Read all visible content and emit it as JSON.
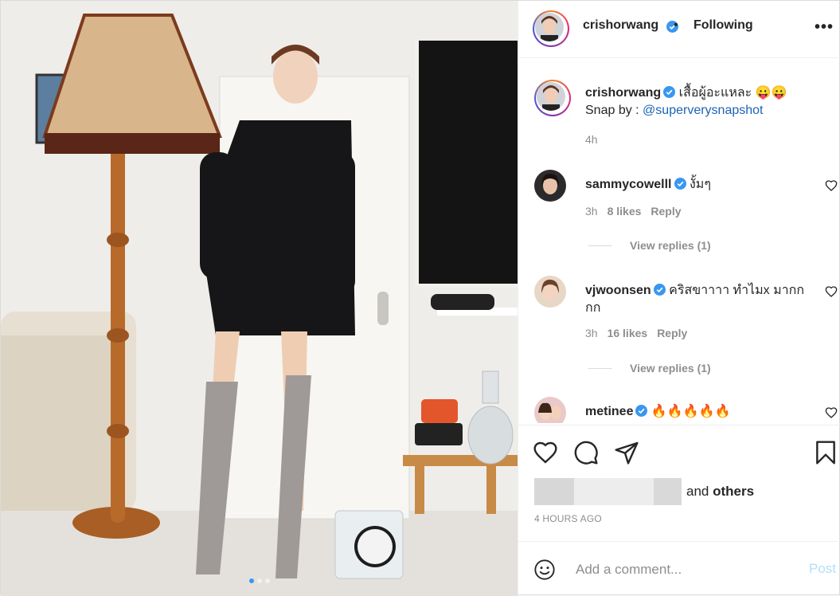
{
  "header": {
    "username": "crishorwang",
    "separator": "•",
    "follow_state": "Following",
    "more": "•••"
  },
  "caption": {
    "username": "crishorwang",
    "text": "เสื้อผู้อะแหละ 😛😛",
    "snap_prefix": "Snap by : ",
    "snap_link": "@superverysnapshot",
    "time": "4h"
  },
  "comments": [
    {
      "username": "sammycowelll",
      "text": "งั้มๆ",
      "time": "3h",
      "likes": "8 likes",
      "reply": "Reply",
      "view_replies": "View replies (1)"
    },
    {
      "username": "vjwoonsen",
      "text": "คริสขาาาา ทำไมx มากกกก",
      "time": "3h",
      "likes": "16 likes",
      "reply": "Reply",
      "view_replies": "View replies (1)"
    },
    {
      "username": "metinee",
      "text": "🔥🔥🔥🔥🔥"
    }
  ],
  "likes": {
    "suffix_plain": "and",
    "suffix_bold": "others"
  },
  "timestamp": "4 HOURS AGO",
  "comment_box": {
    "placeholder": "Add a comment...",
    "post_label": "Post"
  },
  "carousel": {
    "slides": 3,
    "active": 1
  },
  "colors": {
    "verified": "#3897f0",
    "post_disabled": "#b2dffc",
    "muted": "#8e8e8e",
    "link": "#1b63b5"
  }
}
